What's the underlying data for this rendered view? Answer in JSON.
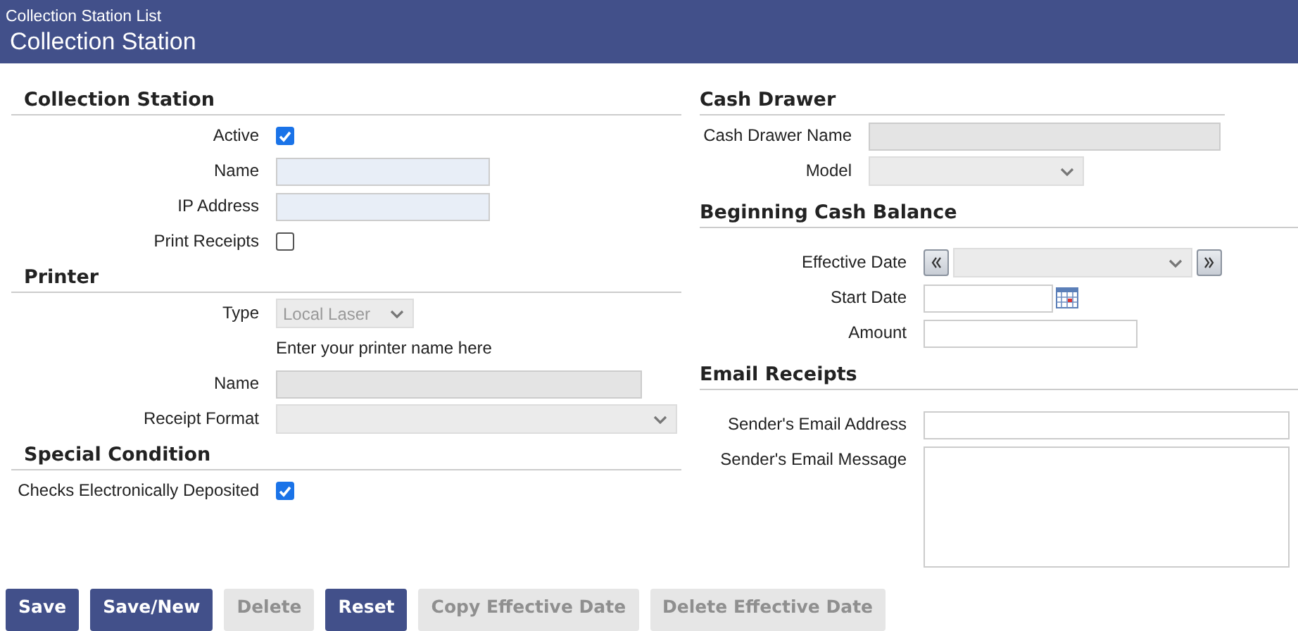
{
  "breadcrumb": "Collection Station List",
  "title": "Collection Station",
  "left_sections": [
    {
      "heading": "Collection Station",
      "fields": [
        {
          "kind": "checkbox",
          "label": "Active",
          "checked": true
        },
        {
          "kind": "text",
          "label": "Name",
          "disabled": false,
          "required": true
        },
        {
          "kind": "text",
          "label": "IP Address",
          "disabled": false,
          "required": true
        },
        {
          "kind": "checkbox",
          "label": "Print Receipts",
          "checked": false
        }
      ]
    },
    {
      "heading": "Printer",
      "fields": [
        {
          "kind": "select",
          "label": "Type",
          "value": "Local Laser",
          "disabled": true
        },
        {
          "kind": "note",
          "text": "Enter your printer name here"
        },
        {
          "kind": "text",
          "label": "Name",
          "disabled": true
        },
        {
          "kind": "select",
          "label": "Receipt Format",
          "disabled": true
        }
      ]
    },
    {
      "heading": "Special Condition",
      "fields": [
        {
          "kind": "checkbox",
          "label": "Checks Electronically Deposited",
          "checked": true
        }
      ]
    }
  ],
  "right_sections": [
    {
      "heading": "Cash Drawer",
      "fields": [
        {
          "kind": "text",
          "label": "Cash Drawer Name",
          "disabled": true
        },
        {
          "kind": "select",
          "label": "Model",
          "disabled": true
        }
      ]
    },
    {
      "heading": "Beginning Cash Balance",
      "fields": [
        {
          "kind": "stepper",
          "label": "Effective Date",
          "disabled": true
        },
        {
          "kind": "date",
          "label": "Start Date",
          "disabled": false,
          "required": false
        },
        {
          "kind": "text",
          "label": "Amount",
          "disabled": false,
          "required": false
        }
      ]
    },
    {
      "heading": "Email Receipts",
      "fields": [
        {
          "kind": "text",
          "label": "Sender's Email Address",
          "disabled": false,
          "required": false
        },
        {
          "kind": "textarea",
          "label": "Sender's Email Message",
          "disabled": false
        }
      ]
    }
  ],
  "buttons": [
    {
      "label": "Save",
      "disabled": false
    },
    {
      "label": "Save/New",
      "disabled": false
    },
    {
      "label": "Delete",
      "disabled": true
    },
    {
      "label": "Reset",
      "disabled": false
    },
    {
      "label": "Copy Effective Date",
      "disabled": true
    },
    {
      "label": "Delete Effective Date",
      "disabled": true
    }
  ]
}
